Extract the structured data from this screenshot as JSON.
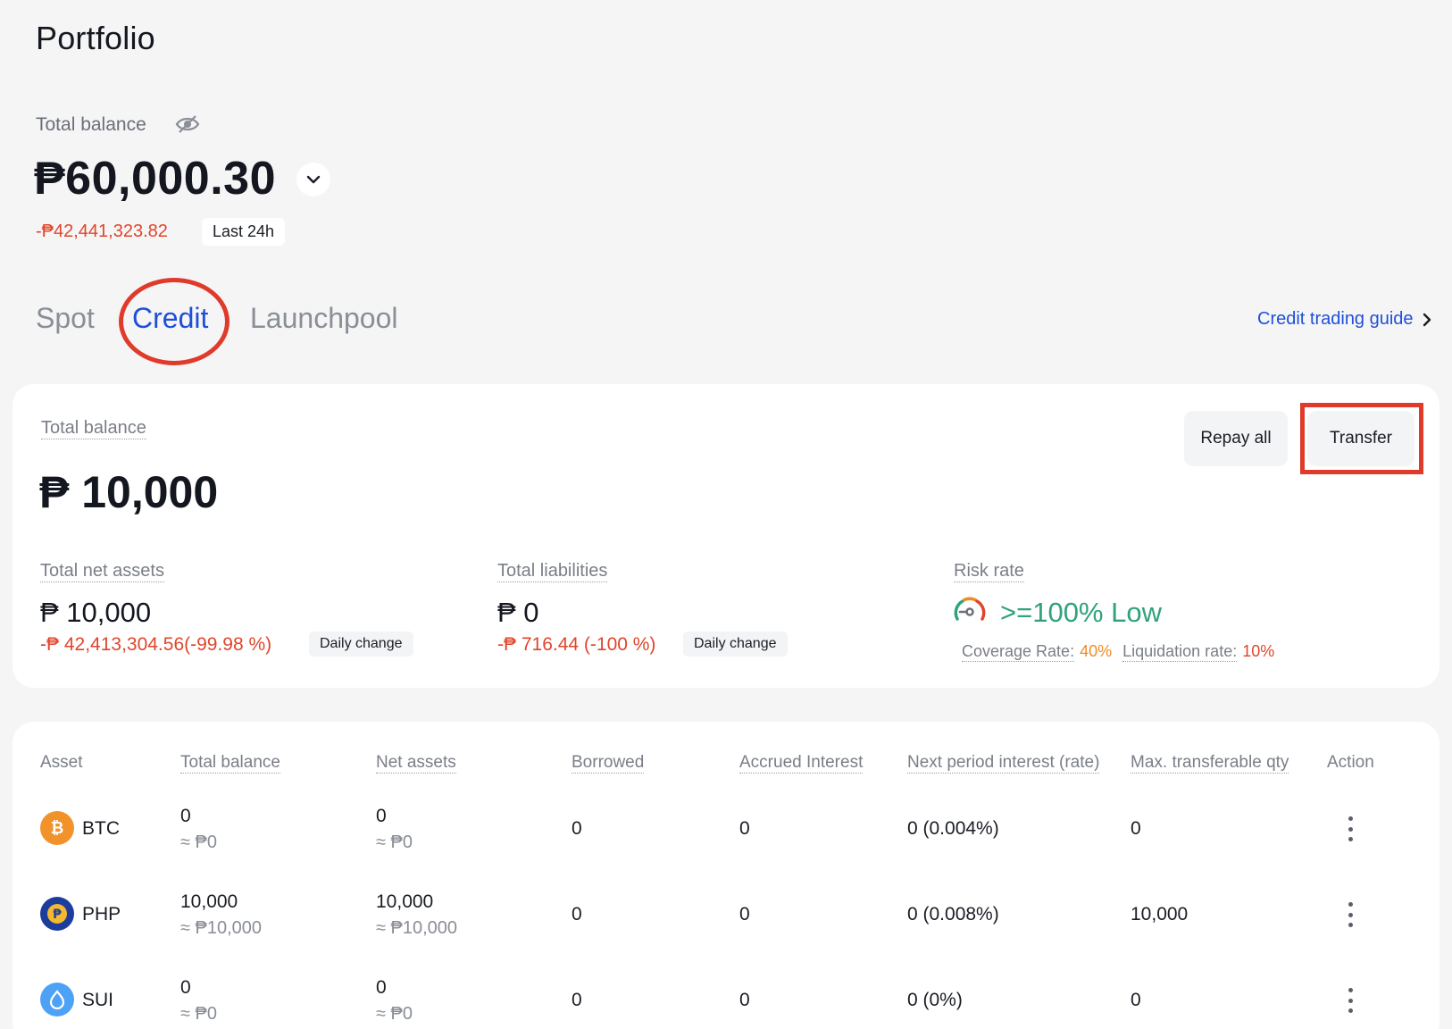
{
  "page": {
    "title": "Portfolio"
  },
  "overview": {
    "total_balance_label": "Total balance",
    "total_balance": "₱60,000.30",
    "change_24h": "-₱42,441,323.82",
    "change_period": "Last 24h"
  },
  "tabs": [
    {
      "label": "Spot",
      "active": false
    },
    {
      "label": "Credit",
      "active": true
    },
    {
      "label": "Launchpool",
      "active": false
    }
  ],
  "guide_link": "Credit trading guide",
  "credit": {
    "total_balance_label": "Total balance",
    "total_balance": "₱ 10,000",
    "repay_all": "Repay all",
    "transfer": "Transfer",
    "net_assets": {
      "label": "Total net assets",
      "value": "₱ 10,000",
      "change": "-₱ 42,413,304.56(-99.98 %)",
      "badge": "Daily change"
    },
    "liabilities": {
      "label": "Total liabilities",
      "value": "₱ 0",
      "change": "-₱ 716.44 (-100 %)",
      "badge": "Daily change"
    },
    "risk": {
      "label": "Risk rate",
      "value": ">=100% Low",
      "coverage_label": "Coverage Rate:",
      "coverage_value": "40%",
      "liquidation_label": "Liquidation rate:",
      "liquidation_value": "10%"
    }
  },
  "table": {
    "headers": [
      "Asset",
      "Total balance",
      "Net assets",
      "Borrowed",
      "Accrued Interest",
      "Next period interest (rate)",
      "Max. transferable qty",
      "Action"
    ],
    "rows": [
      {
        "asset": "BTC",
        "icon": "bitcoin-icon",
        "color": "#f2922a",
        "total": "0",
        "total_fiat": "≈ ₱0",
        "net": "0",
        "net_fiat": "≈ ₱0",
        "borrowed": "0",
        "accrued": "0",
        "next_interest": "0 (0.004%)",
        "max_transfer": "0"
      },
      {
        "asset": "PHP",
        "icon": "peso-coin-icon",
        "color": "#1c3d9c",
        "total": "10,000",
        "total_fiat": "≈ ₱10,000",
        "net": "10,000",
        "net_fiat": "≈ ₱10,000",
        "borrowed": "0",
        "accrued": "0",
        "next_interest": "0 (0.008%)",
        "max_transfer": "10,000"
      },
      {
        "asset": "SUI",
        "icon": "sui-drop-icon",
        "color": "#4ea2f5",
        "total": "0",
        "total_fiat": "≈ ₱0",
        "net": "0",
        "net_fiat": "≈ ₱0",
        "borrowed": "0",
        "accrued": "0",
        "next_interest": "0 (0%)",
        "max_transfer": "0"
      }
    ]
  }
}
